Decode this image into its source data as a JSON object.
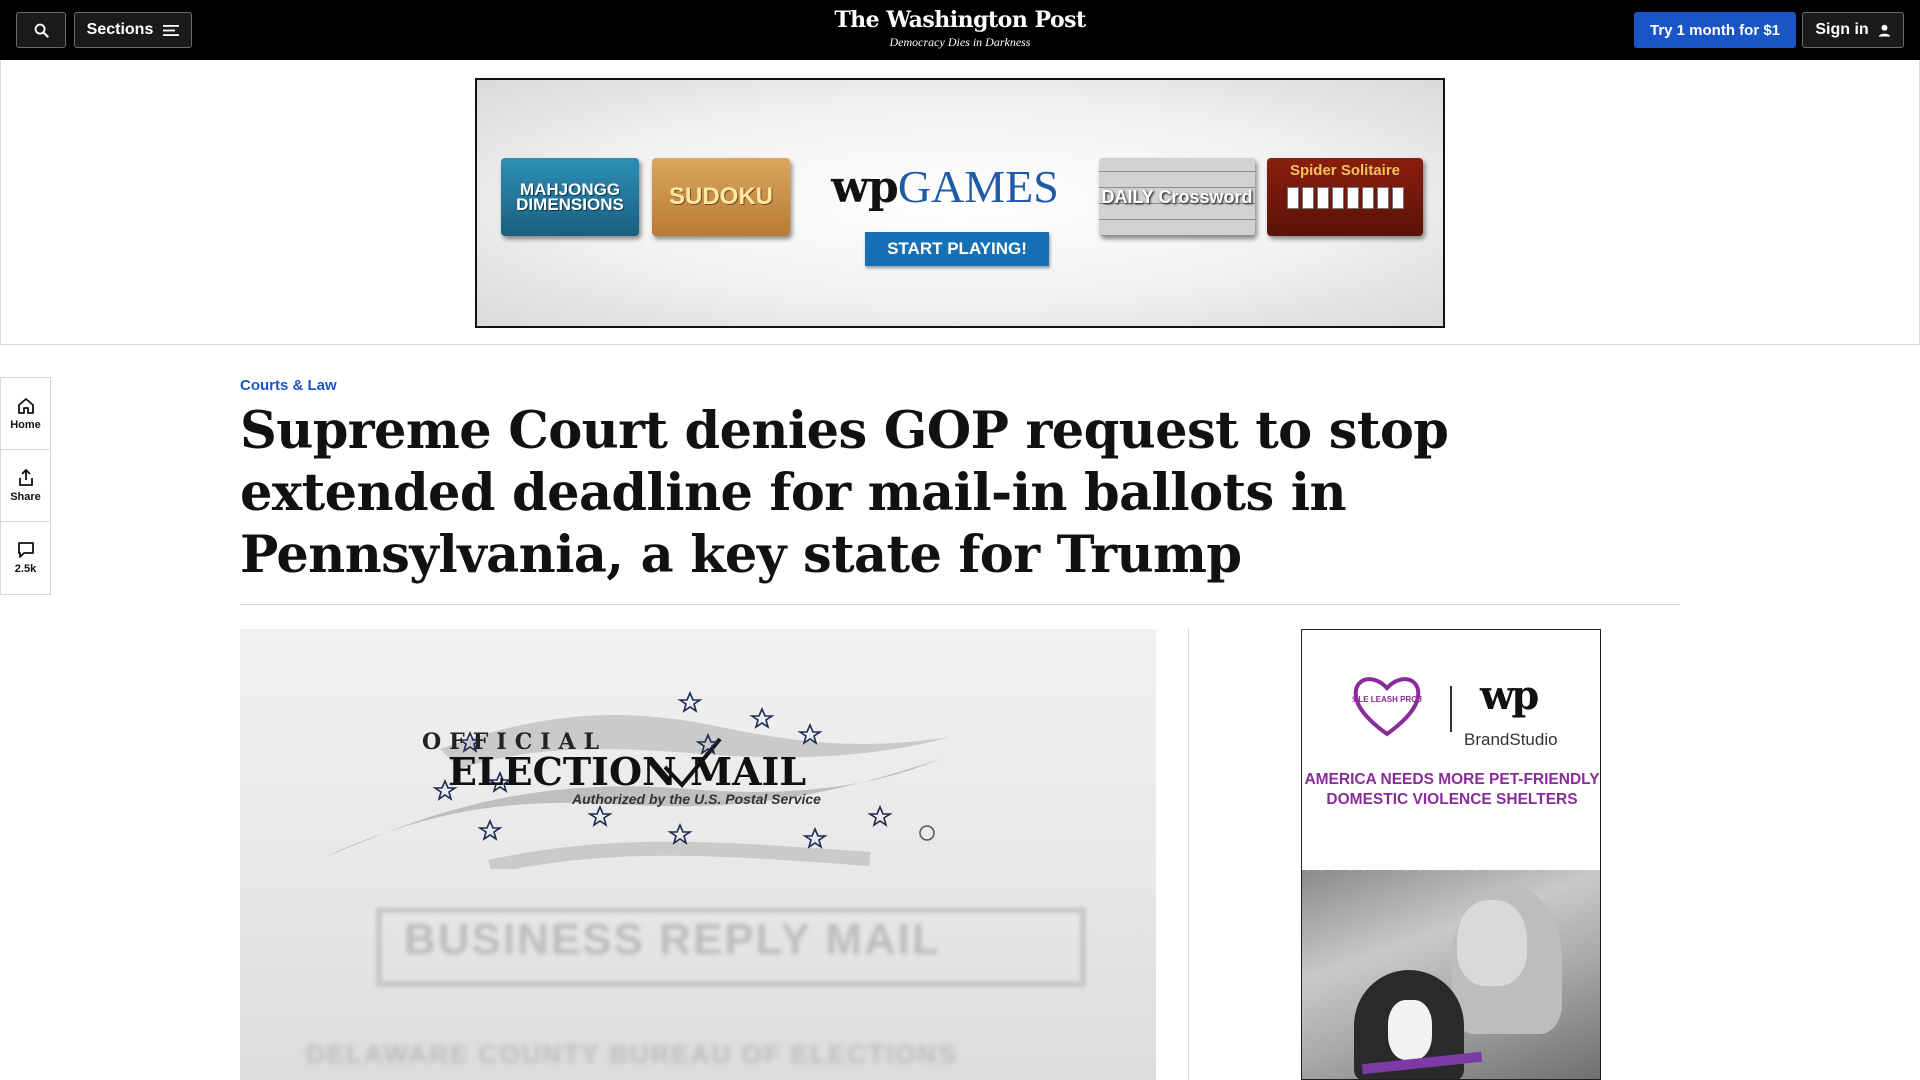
{
  "nav": {
    "sections_label": "Sections",
    "logo_title": "The Washington Post",
    "logo_tagline": "Democracy Dies in Darkness",
    "try_label": "Try 1 month for $1",
    "signin_label": "Sign in"
  },
  "top_ad": {
    "mahjongg": "MAHJONGG DIMENSIONS",
    "sudoku": "SUDOKU",
    "wp_games_mark": "wp",
    "wp_games_word": "GAMES",
    "start": "START PLAYING!",
    "crossword": "DAILY Crossword",
    "solitaire": "Spider Solitaire"
  },
  "rail": {
    "home": "Home",
    "share": "Share",
    "comments": "2.5k"
  },
  "article": {
    "kicker": "Courts & Law",
    "headline": "Supreme Court denies GOP request to stop extended deadline for mail-in ballots in Pennsylvania, a key state for Trump"
  },
  "hero": {
    "official": "OFFICIAL",
    "election_mail": "ELECTION MAIL",
    "authorized": "Authorized by the U.S. Postal Service",
    "business_reply": "BUSINESS REPLY MAIL",
    "delaware": "DELAWARE COUNTY BUREAU OF ELECTIONS"
  },
  "side_ad": {
    "brand": "PURPLE LEASH PROJECT",
    "wp_mark": "wp",
    "brand_studio": "BrandStudio",
    "headline": "AMERICA NEEDS MORE PET-FRIENDLY DOMESTIC VIOLENCE SHELTERS"
  },
  "colors": {
    "nav_bg": "#000000",
    "accent_blue": "#1955c4",
    "ad_purple": "#8a2b9b"
  }
}
